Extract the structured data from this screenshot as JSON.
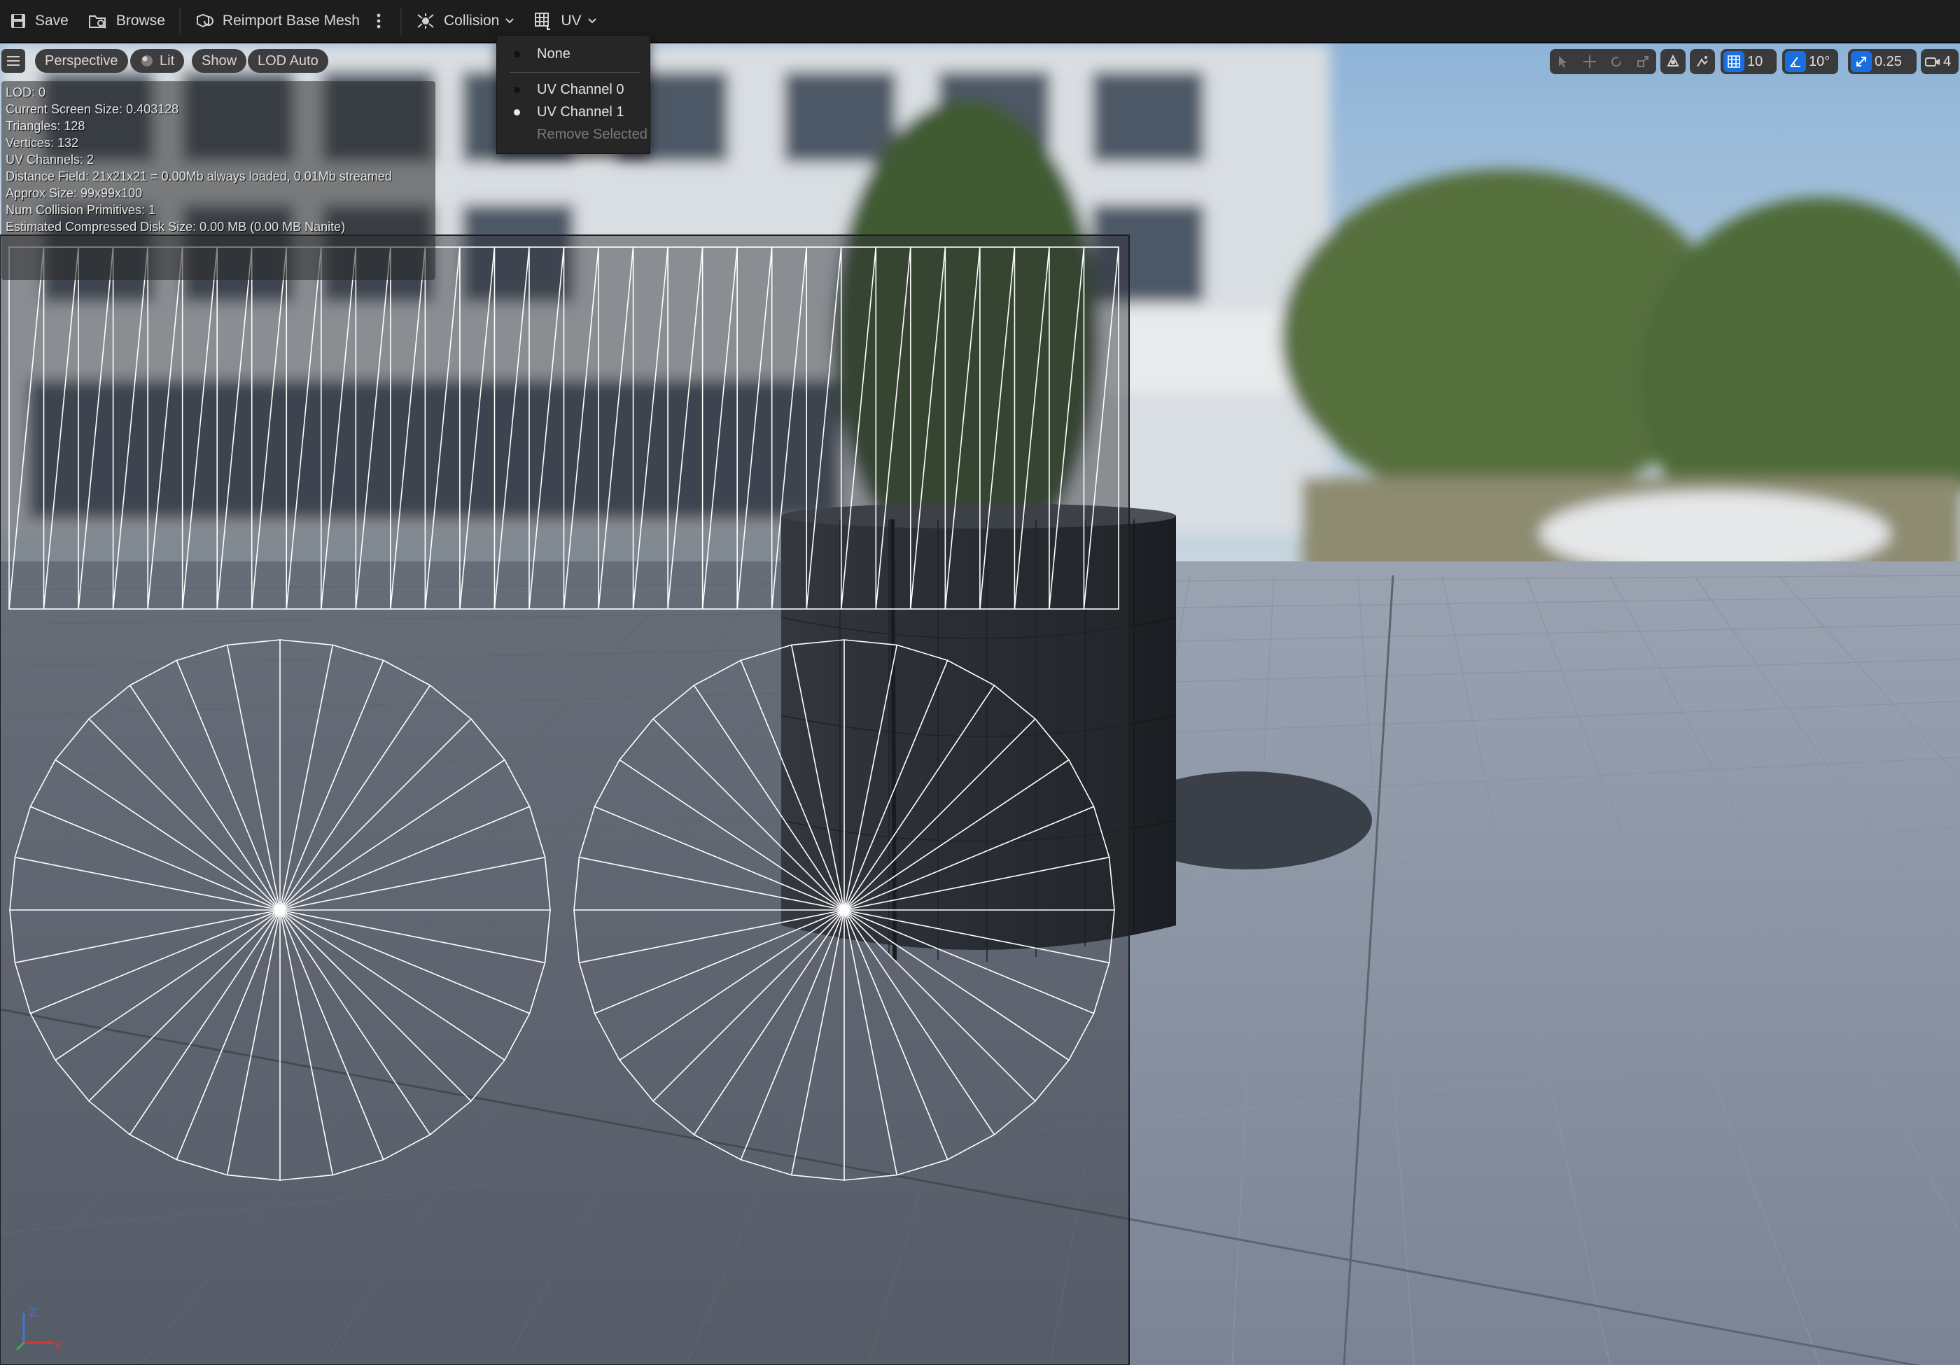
{
  "toolbar": {
    "save_label": "Save",
    "browse_label": "Browse",
    "reimport_label": "Reimport Base Mesh",
    "collision_label": "Collision",
    "uv_label": "UV"
  },
  "viewport_toolbar": {
    "perspective_label": "Perspective",
    "lit_label": "Lit",
    "show_label": "Show",
    "lod_label": "LOD Auto",
    "grid_snap_value": "10",
    "rotation_snap_value": "10°",
    "scale_snap_value": "0.25",
    "camera_speed_value": "4"
  },
  "uv_menu": {
    "items": [
      {
        "label": "None",
        "selected": false,
        "enabled": true
      },
      {
        "label": "UV Channel 0",
        "selected": false,
        "enabled": true
      },
      {
        "label": "UV Channel 1",
        "selected": true,
        "enabled": true
      },
      {
        "label": "Remove Selected",
        "selected": false,
        "enabled": false
      }
    ]
  },
  "stats": {
    "lines": [
      "LOD:  0",
      "Current Screen Size:  0.403128",
      "Triangles:  128",
      "Vertices:  132",
      "UV Channels:  2",
      "Distance Field:  21x21x21 = 0.00Mb always loaded, 0.01Mb streamed",
      "Approx Size: 99x99x100",
      "Num Collision Primitives:  1",
      "Estimated Compressed Disk Size: 0.00 MB (0.00 MB Nanite)"
    ]
  },
  "axis_gizmo": {
    "z": "Z",
    "x": "X"
  },
  "colors": {
    "accent_blue": "#1a6fe0",
    "toolbar_bg": "#1d1d1d",
    "uv_wire": "#ffffff"
  },
  "icons": {
    "save": "floppy-disk-icon",
    "browse": "folder-browse-icon",
    "reimport": "reimport-icon",
    "collision": "collision-icon",
    "uv": "uv-grid-icon"
  }
}
